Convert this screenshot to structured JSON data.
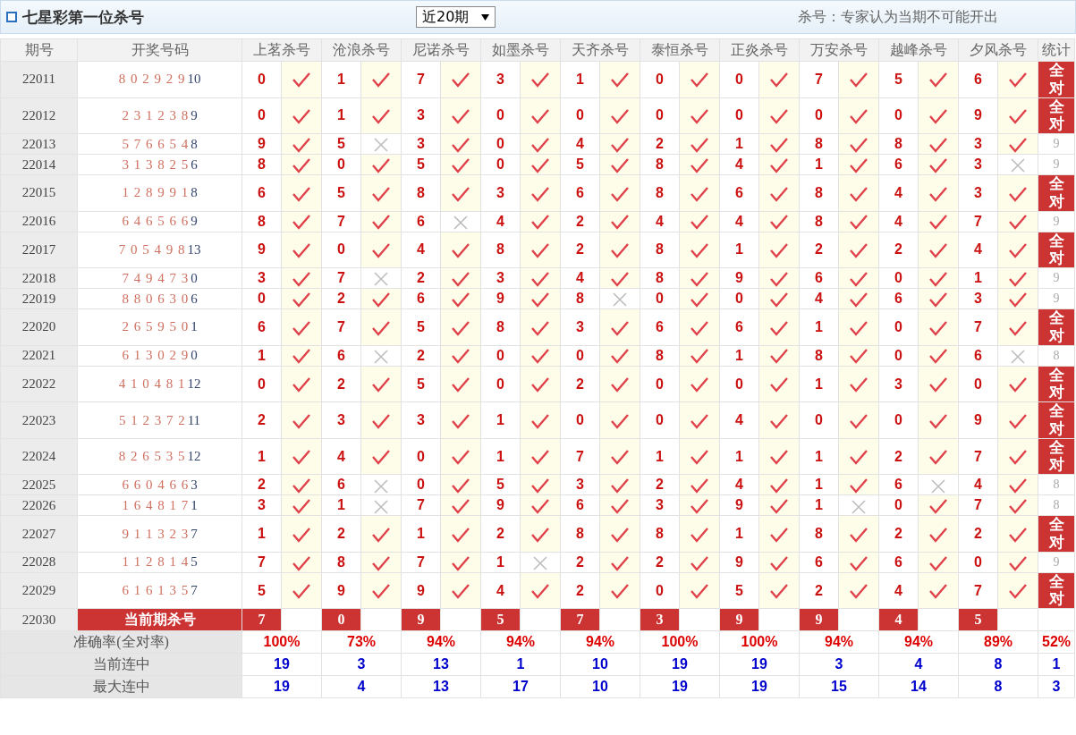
{
  "header": {
    "title": "七星彩第一位杀号",
    "period_select": "近20期",
    "note": "杀号：专家认为当期不可能开出"
  },
  "columns": [
    "期号",
    "开奖号码",
    "上茗杀号",
    "沧浪杀号",
    "尼诺杀号",
    "如墨杀号",
    "天齐杀号",
    "泰恒杀号",
    "正炎杀号",
    "万安杀号",
    "越峰杀号",
    "夕风杀号",
    "统计"
  ],
  "rows": [
    {
      "period": "22011",
      "draw": "8 0 2 9 2 9",
      "extra": "10",
      "kills": [
        {
          "number": "0",
          "hit": true
        },
        {
          "number": "1",
          "hit": true
        },
        {
          "number": "7",
          "hit": true
        },
        {
          "number": "3",
          "hit": true
        },
        {
          "number": "1",
          "hit": true
        },
        {
          "number": "0",
          "hit": true
        },
        {
          "number": "0",
          "hit": true
        },
        {
          "number": "7",
          "hit": true
        },
        {
          "number": "5",
          "hit": true
        },
        {
          "number": "6",
          "hit": true
        }
      ],
      "stat": {
        "kind": "full",
        "text": "全对"
      }
    },
    {
      "period": "22012",
      "draw": "2 3 1 2 3 8",
      "extra": "9",
      "kills": [
        {
          "number": "0",
          "hit": true
        },
        {
          "number": "1",
          "hit": true
        },
        {
          "number": "3",
          "hit": true
        },
        {
          "number": "0",
          "hit": true
        },
        {
          "number": "0",
          "hit": true
        },
        {
          "number": "0",
          "hit": true
        },
        {
          "number": "0",
          "hit": true
        },
        {
          "number": "0",
          "hit": true
        },
        {
          "number": "0",
          "hit": true
        },
        {
          "number": "9",
          "hit": true
        }
      ],
      "stat": {
        "kind": "full",
        "text": "全对"
      }
    },
    {
      "period": "22013",
      "draw": "5 7 6 6 5 4",
      "extra": "8",
      "kills": [
        {
          "number": "9",
          "hit": true
        },
        {
          "number": "5",
          "hit": false
        },
        {
          "number": "3",
          "hit": true
        },
        {
          "number": "0",
          "hit": true
        },
        {
          "number": "4",
          "hit": true
        },
        {
          "number": "2",
          "hit": true
        },
        {
          "number": "1",
          "hit": true
        },
        {
          "number": "8",
          "hit": true
        },
        {
          "number": "8",
          "hit": true
        },
        {
          "number": "3",
          "hit": true
        }
      ],
      "stat": {
        "kind": "count",
        "text": "9"
      }
    },
    {
      "period": "22014",
      "draw": "3 1 3 8 2 5",
      "extra": "6",
      "kills": [
        {
          "number": "8",
          "hit": true
        },
        {
          "number": "0",
          "hit": true
        },
        {
          "number": "5",
          "hit": true
        },
        {
          "number": "0",
          "hit": true
        },
        {
          "number": "5",
          "hit": true
        },
        {
          "number": "8",
          "hit": true
        },
        {
          "number": "4",
          "hit": true
        },
        {
          "number": "1",
          "hit": true
        },
        {
          "number": "6",
          "hit": true
        },
        {
          "number": "3",
          "hit": false
        }
      ],
      "stat": {
        "kind": "count",
        "text": "9"
      }
    },
    {
      "period": "22015",
      "draw": "1 2 8 9 9 1",
      "extra": "8",
      "kills": [
        {
          "number": "6",
          "hit": true
        },
        {
          "number": "5",
          "hit": true
        },
        {
          "number": "8",
          "hit": true
        },
        {
          "number": "3",
          "hit": true
        },
        {
          "number": "6",
          "hit": true
        },
        {
          "number": "8",
          "hit": true
        },
        {
          "number": "6",
          "hit": true
        },
        {
          "number": "8",
          "hit": true
        },
        {
          "number": "4",
          "hit": true
        },
        {
          "number": "3",
          "hit": true
        }
      ],
      "stat": {
        "kind": "full",
        "text": "全对"
      }
    },
    {
      "period": "22016",
      "draw": "6 4 6 5 6 6",
      "extra": "9",
      "kills": [
        {
          "number": "8",
          "hit": true
        },
        {
          "number": "7",
          "hit": true
        },
        {
          "number": "6",
          "hit": false
        },
        {
          "number": "4",
          "hit": true
        },
        {
          "number": "2",
          "hit": true
        },
        {
          "number": "4",
          "hit": true
        },
        {
          "number": "4",
          "hit": true
        },
        {
          "number": "8",
          "hit": true
        },
        {
          "number": "4",
          "hit": true
        },
        {
          "number": "7",
          "hit": true
        }
      ],
      "stat": {
        "kind": "count",
        "text": "9"
      }
    },
    {
      "period": "22017",
      "draw": "7 0 5 4 9 8",
      "extra": "13",
      "kills": [
        {
          "number": "9",
          "hit": true
        },
        {
          "number": "0",
          "hit": true
        },
        {
          "number": "4",
          "hit": true
        },
        {
          "number": "8",
          "hit": true
        },
        {
          "number": "2",
          "hit": true
        },
        {
          "number": "8",
          "hit": true
        },
        {
          "number": "1",
          "hit": true
        },
        {
          "number": "2",
          "hit": true
        },
        {
          "number": "2",
          "hit": true
        },
        {
          "number": "4",
          "hit": true
        }
      ],
      "stat": {
        "kind": "full",
        "text": "全对"
      }
    },
    {
      "period": "22018",
      "draw": "7 4 9 4 7 3",
      "extra": "0",
      "kills": [
        {
          "number": "3",
          "hit": true
        },
        {
          "number": "7",
          "hit": false
        },
        {
          "number": "2",
          "hit": true
        },
        {
          "number": "3",
          "hit": true
        },
        {
          "number": "4",
          "hit": true
        },
        {
          "number": "8",
          "hit": true
        },
        {
          "number": "9",
          "hit": true
        },
        {
          "number": "6",
          "hit": true
        },
        {
          "number": "0",
          "hit": true
        },
        {
          "number": "1",
          "hit": true
        }
      ],
      "stat": {
        "kind": "count",
        "text": "9"
      }
    },
    {
      "period": "22019",
      "draw": "8 8 0 6 3 0",
      "extra": "6",
      "kills": [
        {
          "number": "0",
          "hit": true
        },
        {
          "number": "2",
          "hit": true
        },
        {
          "number": "6",
          "hit": true
        },
        {
          "number": "9",
          "hit": true
        },
        {
          "number": "8",
          "hit": false
        },
        {
          "number": "0",
          "hit": true
        },
        {
          "number": "0",
          "hit": true
        },
        {
          "number": "4",
          "hit": true
        },
        {
          "number": "6",
          "hit": true
        },
        {
          "number": "3",
          "hit": true
        }
      ],
      "stat": {
        "kind": "count",
        "text": "9"
      }
    },
    {
      "period": "22020",
      "draw": "2 6 5 9 5 0",
      "extra": "1",
      "kills": [
        {
          "number": "6",
          "hit": true
        },
        {
          "number": "7",
          "hit": true
        },
        {
          "number": "5",
          "hit": true
        },
        {
          "number": "8",
          "hit": true
        },
        {
          "number": "3",
          "hit": true
        },
        {
          "number": "6",
          "hit": true
        },
        {
          "number": "6",
          "hit": true
        },
        {
          "number": "1",
          "hit": true
        },
        {
          "number": "0",
          "hit": true
        },
        {
          "number": "7",
          "hit": true
        }
      ],
      "stat": {
        "kind": "full",
        "text": "全对"
      }
    },
    {
      "period": "22021",
      "draw": "6 1 3 0 2 9",
      "extra": "0",
      "kills": [
        {
          "number": "1",
          "hit": true
        },
        {
          "number": "6",
          "hit": false
        },
        {
          "number": "2",
          "hit": true
        },
        {
          "number": "0",
          "hit": true
        },
        {
          "number": "0",
          "hit": true
        },
        {
          "number": "8",
          "hit": true
        },
        {
          "number": "1",
          "hit": true
        },
        {
          "number": "8",
          "hit": true
        },
        {
          "number": "0",
          "hit": true
        },
        {
          "number": "6",
          "hit": false
        }
      ],
      "stat": {
        "kind": "count",
        "text": "8"
      }
    },
    {
      "period": "22022",
      "draw": "4 1 0 4 8 1",
      "extra": "12",
      "kills": [
        {
          "number": "0",
          "hit": true
        },
        {
          "number": "2",
          "hit": true
        },
        {
          "number": "5",
          "hit": true
        },
        {
          "number": "0",
          "hit": true
        },
        {
          "number": "2",
          "hit": true
        },
        {
          "number": "0",
          "hit": true
        },
        {
          "number": "0",
          "hit": true
        },
        {
          "number": "1",
          "hit": true
        },
        {
          "number": "3",
          "hit": true
        },
        {
          "number": "0",
          "hit": true
        }
      ],
      "stat": {
        "kind": "full",
        "text": "全对"
      }
    },
    {
      "period": "22023",
      "draw": "5 1 2 3 7 2",
      "extra": "11",
      "kills": [
        {
          "number": "2",
          "hit": true
        },
        {
          "number": "3",
          "hit": true
        },
        {
          "number": "3",
          "hit": true
        },
        {
          "number": "1",
          "hit": true
        },
        {
          "number": "0",
          "hit": true
        },
        {
          "number": "0",
          "hit": true
        },
        {
          "number": "4",
          "hit": true
        },
        {
          "number": "0",
          "hit": true
        },
        {
          "number": "0",
          "hit": true
        },
        {
          "number": "9",
          "hit": true
        }
      ],
      "stat": {
        "kind": "full",
        "text": "全对"
      }
    },
    {
      "period": "22024",
      "draw": "8 2 6 5 3 5",
      "extra": "12",
      "kills": [
        {
          "number": "1",
          "hit": true
        },
        {
          "number": "4",
          "hit": true
        },
        {
          "number": "0",
          "hit": true
        },
        {
          "number": "1",
          "hit": true
        },
        {
          "number": "7",
          "hit": true
        },
        {
          "number": "1",
          "hit": true
        },
        {
          "number": "1",
          "hit": true
        },
        {
          "number": "1",
          "hit": true
        },
        {
          "number": "2",
          "hit": true
        },
        {
          "number": "7",
          "hit": true
        }
      ],
      "stat": {
        "kind": "full",
        "text": "全对"
      }
    },
    {
      "period": "22025",
      "draw": "6 6 0 4 6 6",
      "extra": "3",
      "kills": [
        {
          "number": "2",
          "hit": true
        },
        {
          "number": "6",
          "hit": false
        },
        {
          "number": "0",
          "hit": true
        },
        {
          "number": "5",
          "hit": true
        },
        {
          "number": "3",
          "hit": true
        },
        {
          "number": "2",
          "hit": true
        },
        {
          "number": "4",
          "hit": true
        },
        {
          "number": "1",
          "hit": true
        },
        {
          "number": "6",
          "hit": false
        },
        {
          "number": "4",
          "hit": true
        }
      ],
      "stat": {
        "kind": "count",
        "text": "8"
      }
    },
    {
      "period": "22026",
      "draw": "1 6 4 8 1 7",
      "extra": "1",
      "kills": [
        {
          "number": "3",
          "hit": true
        },
        {
          "number": "1",
          "hit": false
        },
        {
          "number": "7",
          "hit": true
        },
        {
          "number": "9",
          "hit": true
        },
        {
          "number": "6",
          "hit": true
        },
        {
          "number": "3",
          "hit": true
        },
        {
          "number": "9",
          "hit": true
        },
        {
          "number": "1",
          "hit": false
        },
        {
          "number": "0",
          "hit": true
        },
        {
          "number": "7",
          "hit": true
        }
      ],
      "stat": {
        "kind": "count",
        "text": "8"
      }
    },
    {
      "period": "22027",
      "draw": "9 1 1 3 2 3",
      "extra": "7",
      "kills": [
        {
          "number": "1",
          "hit": true
        },
        {
          "number": "2",
          "hit": true
        },
        {
          "number": "1",
          "hit": true
        },
        {
          "number": "2",
          "hit": true
        },
        {
          "number": "8",
          "hit": true
        },
        {
          "number": "8",
          "hit": true
        },
        {
          "number": "1",
          "hit": true
        },
        {
          "number": "8",
          "hit": true
        },
        {
          "number": "2",
          "hit": true
        },
        {
          "number": "2",
          "hit": true
        }
      ],
      "stat": {
        "kind": "full",
        "text": "全对"
      }
    },
    {
      "period": "22028",
      "draw": "1 1 2 8 1 4",
      "extra": "5",
      "kills": [
        {
          "number": "7",
          "hit": true
        },
        {
          "number": "8",
          "hit": true
        },
        {
          "number": "7",
          "hit": true
        },
        {
          "number": "1",
          "hit": false
        },
        {
          "number": "2",
          "hit": true
        },
        {
          "number": "2",
          "hit": true
        },
        {
          "number": "9",
          "hit": true
        },
        {
          "number": "6",
          "hit": true
        },
        {
          "number": "6",
          "hit": true
        },
        {
          "number": "0",
          "hit": true
        }
      ],
      "stat": {
        "kind": "count",
        "text": "9"
      }
    },
    {
      "period": "22029",
      "draw": "6 1 6 1 3 5",
      "extra": "7",
      "kills": [
        {
          "number": "5",
          "hit": true
        },
        {
          "number": "9",
          "hit": true
        },
        {
          "number": "9",
          "hit": true
        },
        {
          "number": "4",
          "hit": true
        },
        {
          "number": "2",
          "hit": true
        },
        {
          "number": "0",
          "hit": true
        },
        {
          "number": "5",
          "hit": true
        },
        {
          "number": "2",
          "hit": true
        },
        {
          "number": "4",
          "hit": true
        },
        {
          "number": "7",
          "hit": true
        }
      ],
      "stat": {
        "kind": "full",
        "text": "全对"
      }
    }
  ],
  "current": {
    "period": "22030",
    "label": "当前期杀号",
    "kills": [
      "7",
      "0",
      "9",
      "5",
      "7",
      "3",
      "9",
      "9",
      "4",
      "5"
    ]
  },
  "summary": [
    {
      "label": "准确率(全对率)",
      "kind": "rate",
      "values": [
        "100%",
        "73%",
        "94%",
        "94%",
        "94%",
        "100%",
        "100%",
        "94%",
        "94%",
        "89%",
        "52%"
      ]
    },
    {
      "label": "当前连中",
      "kind": "streak",
      "values": [
        "19",
        "3",
        "13",
        "1",
        "10",
        "19",
        "19",
        "3",
        "4",
        "8",
        "1"
      ]
    },
    {
      "label": "最大连中",
      "kind": "streak",
      "values": [
        "19",
        "4",
        "13",
        "17",
        "10",
        "19",
        "19",
        "15",
        "14",
        "8",
        "3"
      ]
    }
  ]
}
